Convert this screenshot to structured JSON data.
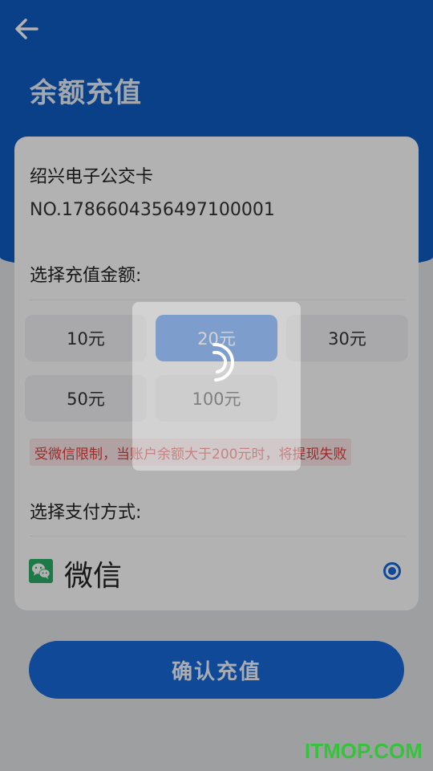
{
  "header": {
    "title": "余额充值",
    "back_icon": "arrow-left-icon"
  },
  "card": {
    "name": "绍兴电子公交卡",
    "number": "NO.1786604356497100001"
  },
  "amount_section": {
    "label": "选择充值金额:",
    "options": [
      {
        "label": "10元",
        "selected": false
      },
      {
        "label": "20元",
        "selected": true
      },
      {
        "label": "30元",
        "selected": false
      },
      {
        "label": "50元",
        "selected": false
      },
      {
        "label": "100元",
        "selected": false
      }
    ],
    "notice": "受微信限制，当账户余额大于200元时，将提现失败"
  },
  "payment_section": {
    "label": "选择支付方式:",
    "methods": [
      {
        "label": "微信",
        "icon": "wechat-icon",
        "selected": true
      }
    ]
  },
  "confirm_button": {
    "label": "确认充值"
  },
  "loading": {
    "visible": true,
    "icon": "spinner-icon"
  },
  "watermark": "ITMOP.COM",
  "colors": {
    "primary": "#1769d9",
    "header": "#0f5cc2",
    "notice_text": "#e23b3b",
    "wechat": "#2aae67"
  }
}
